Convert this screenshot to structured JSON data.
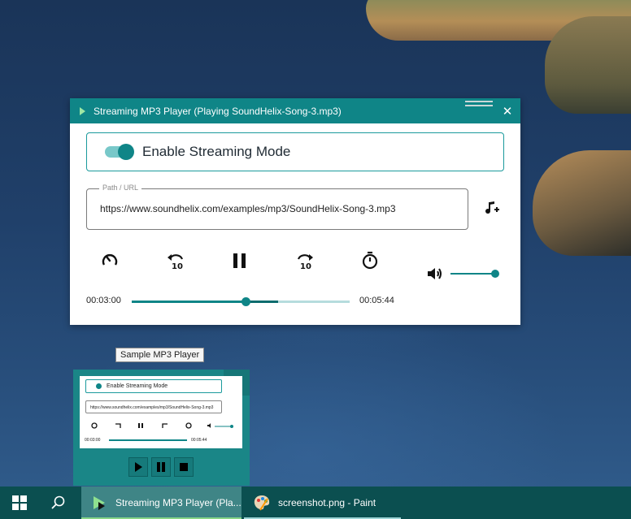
{
  "window": {
    "title": "Streaming MP3 Player (Playing SoundHelix-Song-3.mp3)",
    "close_glyph": "✕"
  },
  "streaming": {
    "label": "Enable Streaming Mode",
    "enabled": true
  },
  "path": {
    "legend": "Path / URL",
    "value": "https://www.soundhelix.com/examples/mp3/SoundHelix-Song-3.mp3"
  },
  "controls": {
    "icons": [
      "speed-icon",
      "rewind-10-icon",
      "pause-icon",
      "forward-10-icon",
      "timer-icon",
      "add-music-icon",
      "volume-icon"
    ],
    "rewind_seconds": "10",
    "forward_seconds": "10",
    "volume_level": 1.0
  },
  "playback": {
    "current_time": "00:03:00",
    "total_time": "00:05:44",
    "progress": 0.523,
    "buffered": 0.67
  },
  "tooltip": {
    "text": "Sample MP3 Player"
  },
  "preview": {
    "close_glyph": "✕",
    "streaming_label": "Enable Streaming Mode",
    "path_value": "https://www.soundhelix.com/examples/mp3/SoundHelix-Song-3.mp3",
    "current_time": "00:03:00",
    "total_time": "00:05:44",
    "toolbar_buttons": [
      "play-icon",
      "pause-icon",
      "stop-icon"
    ]
  },
  "taskbar": {
    "items": [
      {
        "label": "Streaming MP3 Player (Pla...",
        "active": true
      },
      {
        "label": "screenshot.png - Paint",
        "active": false
      }
    ]
  },
  "colors": {
    "accent": "#0f8587",
    "taskbar": "#0b4f50",
    "active_underline": "#87d587"
  }
}
